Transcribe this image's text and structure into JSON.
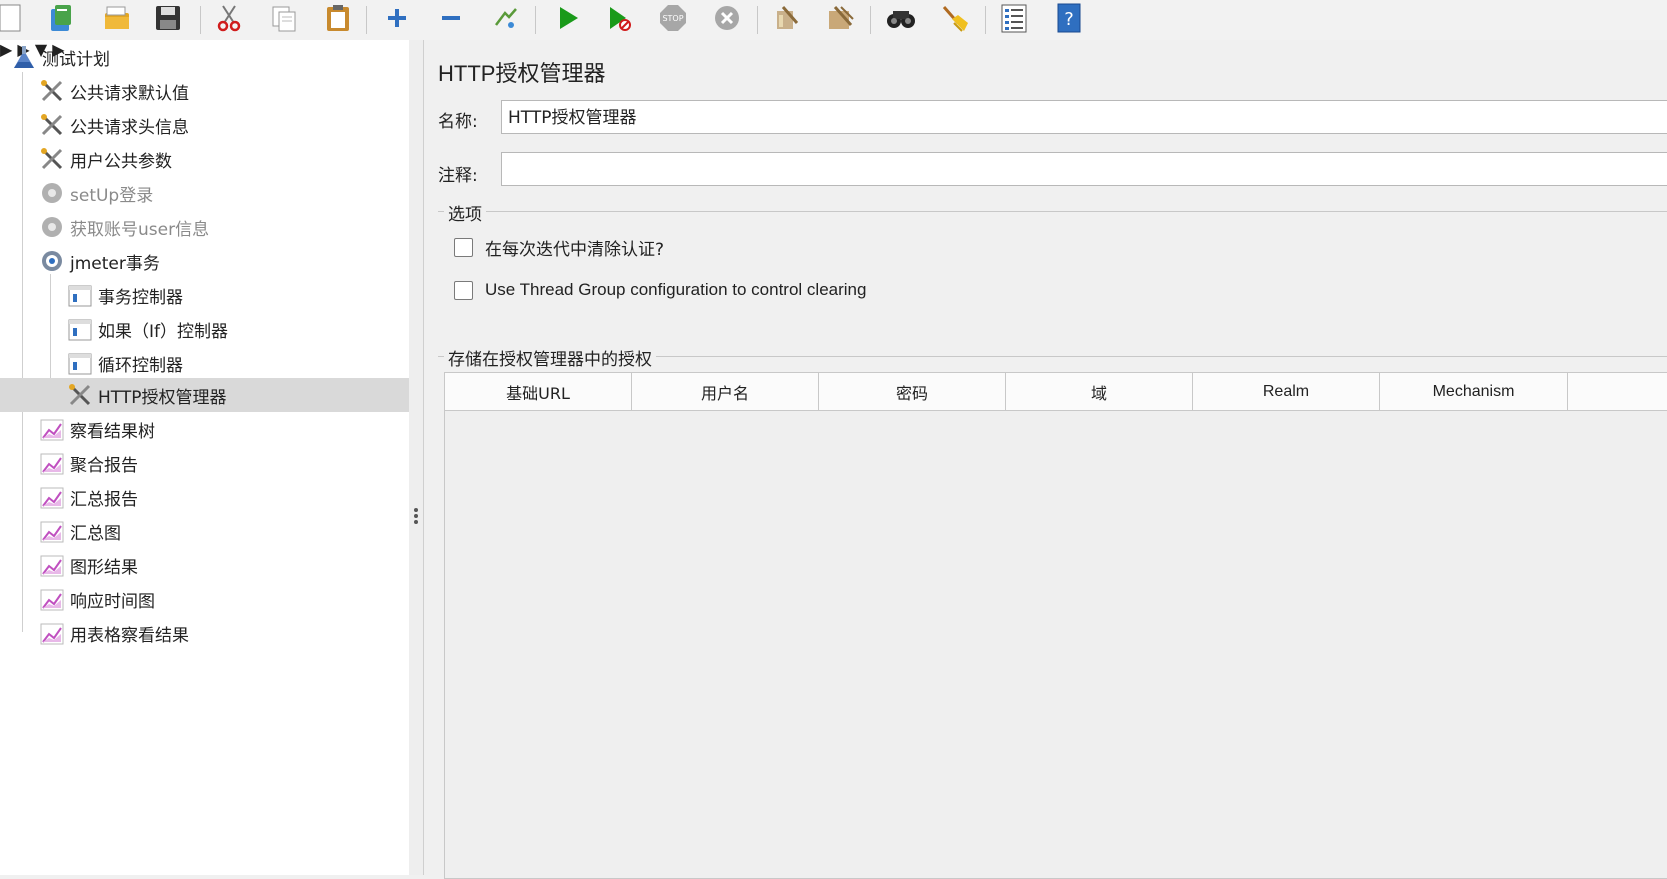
{
  "toolbar": {
    "icons": [
      "new-icon",
      "templates-icon",
      "open-icon",
      "save-icon",
      "cut-icon",
      "copy-icon",
      "paste-icon",
      "expand-icon",
      "collapse-icon",
      "toggle-icon",
      "start-icon",
      "start-no-pause-icon",
      "stop-icon",
      "shutdown-icon",
      "clear-icon",
      "clear-all-icon",
      "search-icon",
      "reset-search-icon",
      "function-helper-icon",
      "help-icon"
    ]
  },
  "tree": {
    "items": [
      {
        "label": "测试计划"
      },
      {
        "label": "公共请求默认值"
      },
      {
        "label": "公共请求头信息"
      },
      {
        "label": "用户公共参数"
      },
      {
        "label": "setUp登录"
      },
      {
        "label": "获取账号user信息"
      },
      {
        "label": "jmeter事务"
      },
      {
        "label": "事务控制器"
      },
      {
        "label": "如果（If）控制器"
      },
      {
        "label": "循环控制器"
      },
      {
        "label": "HTTP授权管理器"
      },
      {
        "label": "察看结果树"
      },
      {
        "label": "聚合报告"
      },
      {
        "label": "汇总报告"
      },
      {
        "label": "汇总图"
      },
      {
        "label": "图形结果"
      },
      {
        "label": "响应时间图"
      },
      {
        "label": "用表格察看结果"
      }
    ]
  },
  "panel": {
    "title": "HTTP授权管理器",
    "name_label": "名称:",
    "name_value": "HTTP授权管理器",
    "comment_label": "注释:",
    "comment_value": "",
    "options_title": "选项",
    "clear_each_iteration": "在每次迭代中清除认证?",
    "use_thread_group": "Use Thread Group configuration to control clearing",
    "stored_title": "存储在授权管理器中的授权",
    "columns": [
      "基础URL",
      "用户名",
      "密码",
      "域",
      "Realm",
      "Mechanism"
    ]
  },
  "colors": {
    "selected_row": "#d9d9d9",
    "disabled_text": "#8a8a8a",
    "run_green": "#1a9a1a"
  }
}
